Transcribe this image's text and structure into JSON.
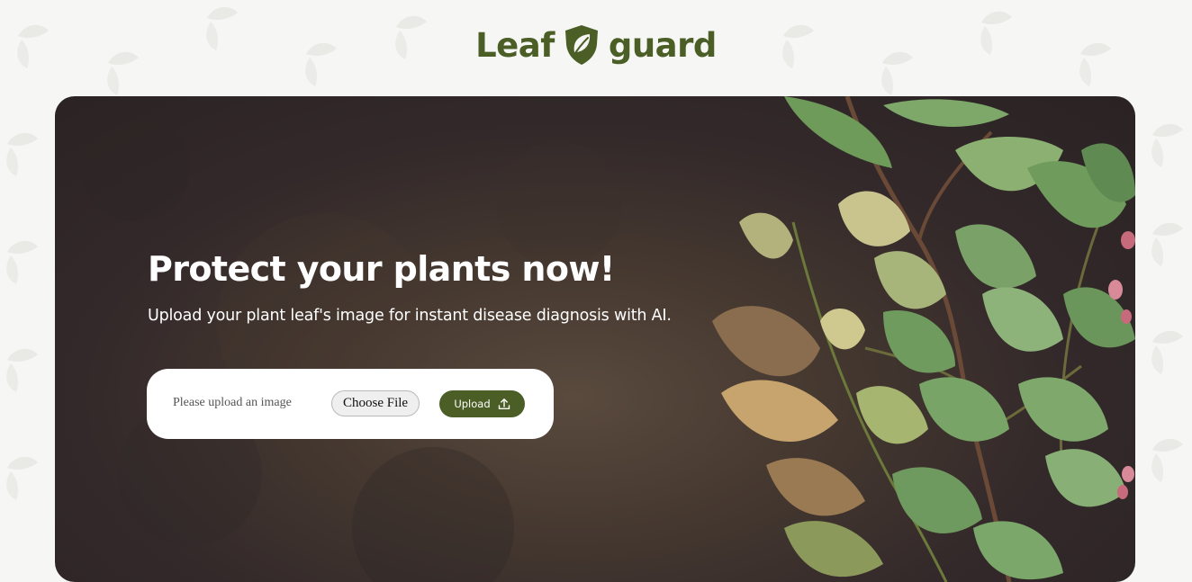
{
  "header": {
    "brand_word_1": "Leaf",
    "brand_word_2": "guard",
    "brand_color": "#4a5e26",
    "logo_icon": "leaf-shield-icon"
  },
  "hero": {
    "title": "Protect your plants now!",
    "subtitle": "Upload your plant leaf's image for instant disease diagnosis with AI.",
    "background_image": "botanical-leaf-illustration"
  },
  "upload": {
    "hint": "Please upload an image",
    "file_button_label": "Choose File",
    "submit_label": "Upload",
    "submit_icon": "upload-icon",
    "accent_color": "#4a5e26"
  }
}
